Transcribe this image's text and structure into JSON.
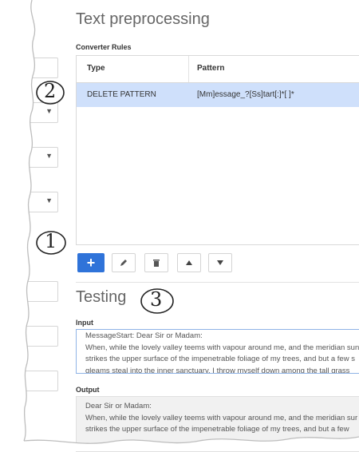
{
  "page_title": "Text preprocessing",
  "converter_rules": {
    "label": "Converter Rules",
    "columns": [
      "Type",
      "Pattern"
    ],
    "rows": [
      {
        "type": "DELETE PATTERN",
        "pattern": "[Mm]essage_?[Ss]tart[:]*[ ]*",
        "selected": true
      }
    ]
  },
  "toolbar": {
    "add": "+",
    "edit_icon": "pencil-icon",
    "delete_icon": "trash-icon",
    "up_icon": "triangle-up-icon",
    "down_icon": "triangle-down-icon"
  },
  "testing": {
    "title": "Testing",
    "input_label": "Input",
    "input_lines": [
      "MessageStart: Dear Sir or Madam:",
      "When, while the lovely valley teems with vapour around me, and the meridian sun",
      "strikes the upper surface of the impenetrable foliage of my trees, and but a few s",
      "gleams steal into the inner sanctuary, I throw myself down among the tall grass"
    ],
    "output_label": "Output",
    "output_lines": [
      "Dear Sir or Madam:",
      "When, while the lovely valley teems with vapour around me, and the meridian sur",
      "strikes the upper surface of the impenetrable foliage of my trees, and but a few"
    ]
  },
  "callouts": [
    "2",
    "1",
    "3"
  ],
  "colors": {
    "accent": "#2f73d9",
    "selected_row": "#cfe0fb"
  }
}
